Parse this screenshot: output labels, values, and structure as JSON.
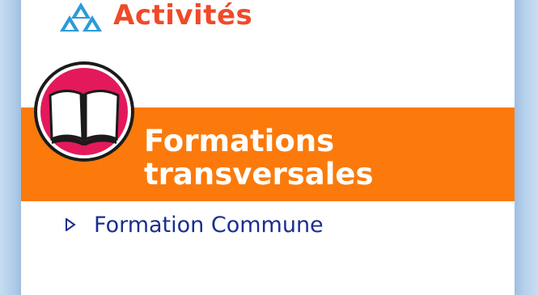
{
  "header": {
    "title": "Activités",
    "icon": "triangle-logo-icon"
  },
  "section": {
    "title_line1": "Formations",
    "title_line2": "transversales",
    "icon": "open-book-icon",
    "band_color": "#fb7a0b"
  },
  "links": [
    {
      "label": "Formation Commune",
      "icon": "triangle-arrow-icon"
    }
  ],
  "colors": {
    "accent_title": "#ef4a2a",
    "link_text": "#1a2e90",
    "frame": "#b7d3ec"
  }
}
